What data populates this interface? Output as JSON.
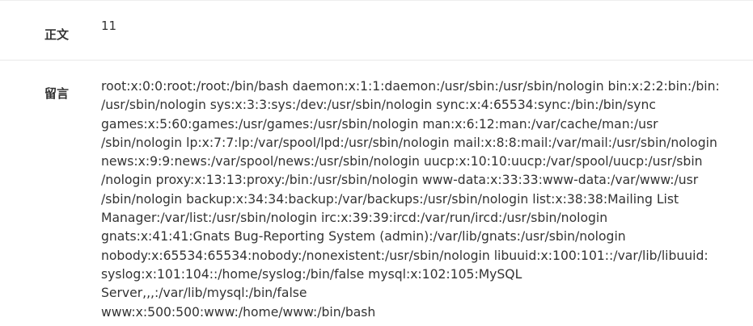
{
  "fields": [
    {
      "label": "正文",
      "value": "11"
    },
    {
      "label": "留言",
      "value": "root:x:0:0:root:/root:/bin/bash daemon:x:1:1:daemon:/usr/sbin:/usr/sbin/nologin bin:x:2:2:bin:/bin:\n/usr/sbin/nologin sys:x:3:3:sys:/dev:/usr/sbin/nologin sync:x:4:65534:sync:/bin:/bin/sync\ngames:x:5:60:games:/usr/games:/usr/sbin/nologin man:x:6:12:man:/var/cache/man:/usr\n/sbin/nologin lp:x:7:7:lp:/var/spool/lpd:/usr/sbin/nologin mail:x:8:8:mail:/var/mail:/usr/sbin/nologin\nnews:x:9:9:news:/var/spool/news:/usr/sbin/nologin uucp:x:10:10:uucp:/var/spool/uucp:/usr/sbin\n/nologin proxy:x:13:13:proxy:/bin:/usr/sbin/nologin www-data:x:33:33:www-data:/var/www:/usr\n/sbin/nologin backup:x:34:34:backup:/var/backups:/usr/sbin/nologin list:x:38:38:Mailing List\nManager:/var/list:/usr/sbin/nologin irc:x:39:39:ircd:/var/run/ircd:/usr/sbin/nologin\ngnats:x:41:41:Gnats Bug-Reporting System (admin):/var/lib/gnats:/usr/sbin/nologin\nnobody:x:65534:65534:nobody:/nonexistent:/usr/sbin/nologin libuuid:x:100:101::/var/lib/libuuid:\nsyslog:x:101:104::/home/syslog:/bin/false mysql:x:102:105:MySQL Server,,,:/var/lib/mysql:/bin/false\nwww:x:500:500:www:/home/www:/bin/bash"
    }
  ]
}
